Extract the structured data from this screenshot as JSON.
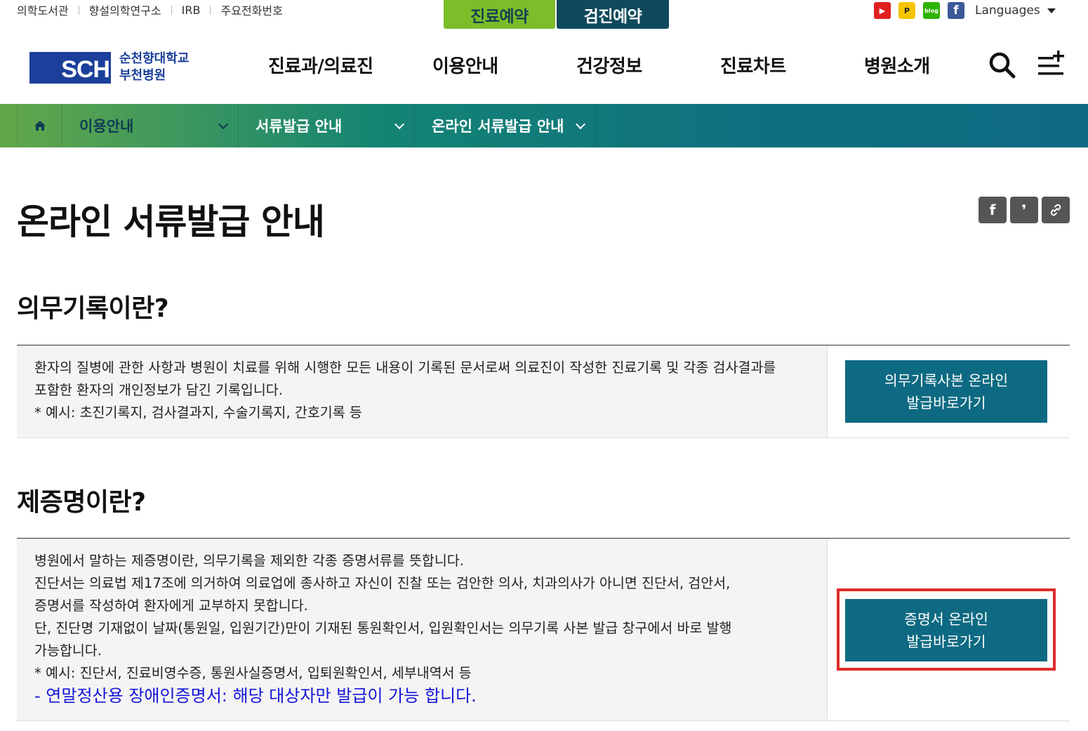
{
  "util_links": [
    "의학도서관",
    "향설의학연구소",
    "IRB",
    "주요전화번호"
  ],
  "quick": {
    "reserve": "진료예약",
    "checkup": "검진예약"
  },
  "sns": {
    "youtube_label": "▶",
    "pc_label": "P",
    "blog_label": "blog",
    "facebook_label": "f",
    "youtube_icon": "youtube-icon",
    "blog_icon": "blog-icon",
    "facebook_icon": "facebook-icon"
  },
  "languages": "Languages",
  "logo": {
    "mark": "SCH",
    "line1": "순천향대학교",
    "line2": "부천병원"
  },
  "gnb": [
    "진료과/의료진",
    "이용안내",
    "건강정보",
    "진료차트",
    "병원소개"
  ],
  "locbar": [
    "이용안내",
    "서류발급 안내",
    "온라인 서류발급 안내"
  ],
  "page_title": "온라인 서류발급 안내",
  "share": {
    "facebook": "f",
    "kakao": "❜",
    "link_icon": "link-icon"
  },
  "sections": [
    {
      "title": "의무기록이란?",
      "lines": [
        "환자의 질병에 관한 사항과 병원이 치료를 위해 시행한 모든 내용이 기록된 문서로써 의료진이 작성한 진료기록 및 각종 검사결과를",
        "포함한 환자의 개인정보가 담긴 기록입니다.",
        "* 예시: 초진기록지, 검사결과지, 수술기록지, 간호기록 등"
      ],
      "button": [
        "의무기록사본 온라인",
        "발급바로가기"
      ]
    },
    {
      "title": "제증명이란?",
      "lines": [
        "병원에서 말하는 제증명이란, 의무기록을 제외한 각종 증명서류를 뜻합니다.",
        "진단서는 의료법 제17조에 의거하여 의료업에 종사하고 자신이 진찰 또는 검안한 의사, 치과의사가 아니면 진단서, 검안서,",
        "증명서를 작성하여 환자에게 교부하지 못합니다.",
        "단, 진단명 기재없이 날짜(통원일, 입원기간)만이 기재된 통원확인서, 입원확인서는 의무기록 사본 발급 창구에서 바로 발행",
        "가능합니다.",
        "* 예시: 진단서, 진료비영수증, 통원사실증명서, 입퇴원확인서, 세부내역서 등"
      ],
      "note": "- 연말정산용 장애인증명서: 해당 대상자만 발급이 가능 합니다.",
      "button": [
        "증명서 온라인",
        "발급바로가기"
      ]
    }
  ],
  "colors": {
    "brand_navy": "#1b3f9a",
    "teal": "#0e6a82",
    "green": "#7cbd2a",
    "highlight_red": "#e02b2b",
    "note_blue": "#1515d8"
  }
}
